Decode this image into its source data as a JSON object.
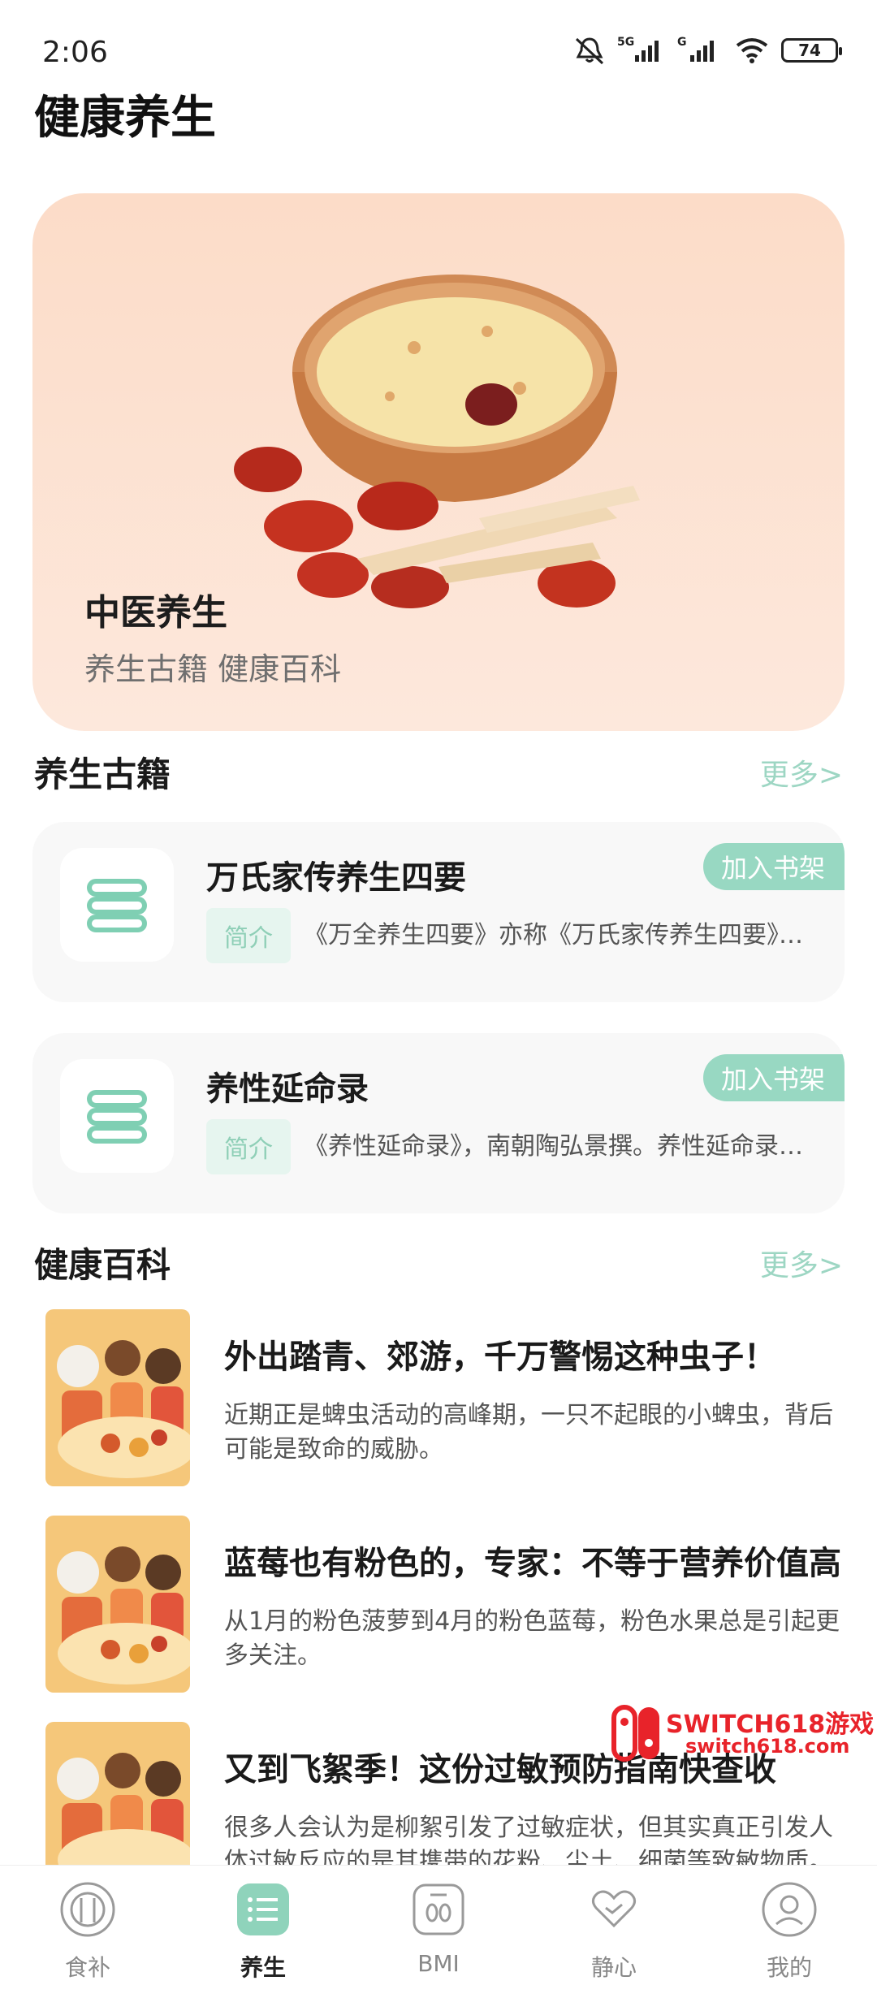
{
  "status_bar": {
    "time": "2:06",
    "battery": "74"
  },
  "page_title": "健康养生",
  "hero": {
    "title": "中医养生",
    "subtitle": "养生古籍  健康百科"
  },
  "classics_section": {
    "title": "养生古籍",
    "more": "更多>",
    "books": [
      {
        "title": "万氏家传养生四要",
        "add_label": "加入书架",
        "tag": "简介",
        "intro": "《万全养生四要》亦称《万氏家传养生四要》，…"
      },
      {
        "title": "养性延命录",
        "add_label": "加入书架",
        "tag": "简介",
        "intro": "《养性延命录》，南朝陶弘景撰。养性延命录序…"
      }
    ]
  },
  "encyclopedia_section": {
    "title": "健康百科",
    "more": "更多>",
    "articles": [
      {
        "title": "外出踏青、郊游，千万警惕这种虫子！",
        "desc": "近期正是蜱虫活动的高峰期，一只不起眼的小蜱虫，背后可能是致命的威胁。"
      },
      {
        "title": "蓝莓也有粉色的，专家：不等于营养价值高",
        "desc": "从1月的粉色菠萝到4月的粉色蓝莓，粉色水果总是引起更多关注。"
      },
      {
        "title": "又到飞絮季！这份过敏预防指南快查收",
        "desc": "很多人会认为是柳絮引发了过敏症状，但其实真正引发人体过敏反应的是其携带的花粉、尘土、细菌等致敏物质。"
      }
    ]
  },
  "watermark": {
    "line1": "SWITCH618游戏",
    "line2": "switch618.com"
  },
  "bottom_nav": {
    "items": [
      {
        "label": "食补",
        "icon": "food-icon"
      },
      {
        "label": "养生",
        "icon": "list-icon"
      },
      {
        "label": "BMI",
        "icon": "scale-icon"
      },
      {
        "label": "静心",
        "icon": "heart-hand-icon"
      },
      {
        "label": "我的",
        "icon": "profile-icon"
      }
    ],
    "active": "养生"
  },
  "colors": {
    "accent": "#98d8c2",
    "hero_bg": "#fcdcc8",
    "card_bg": "#f8f8f8"
  }
}
